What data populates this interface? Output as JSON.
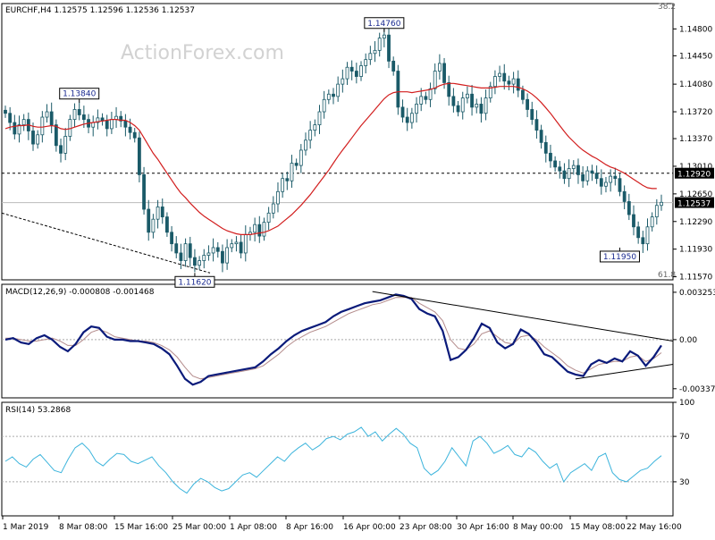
{
  "chart_data": [
    {
      "type": "candlestick",
      "title": "EURCHF,H4  1.12575 1.12596 1.12536 1.12537",
      "watermark": "ActionForex.com",
      "ylim": [
        1.1153,
        1.1513
      ],
      "y_ticks": [
        "1.14800",
        "1.14450",
        "1.14080",
        "1.13720",
        "1.13370",
        "1.13010",
        "1.12650",
        "1.12290",
        "1.11930",
        "1.11570"
      ],
      "x_ticks": [
        "1 Mar 2019",
        "8 Mar 08:00",
        "15 Mar 16:00",
        "25 Mar 00:00",
        "1 Apr 08:00",
        "8 Apr 16:00",
        "16 Apr 00:00",
        "23 Apr 08:00",
        "30 Apr 16:00",
        "8 May 00:00",
        "15 May 08:00",
        "22 May 16:00"
      ],
      "fib_labels": [
        "38.2",
        "61.8"
      ],
      "current_price": "1.12537",
      "horizontal_line": {
        "value": 1.1292,
        "label": "1.12920"
      },
      "callouts": [
        {
          "label": "1.13840",
          "x": 16,
          "y": 1.1384
        },
        {
          "label": "1.14760",
          "x": 84,
          "y": 1.1476
        },
        {
          "label": "1.11620",
          "x": 42,
          "y": 1.1162
        },
        {
          "label": "1.11950",
          "x": 136,
          "y": 1.1195
        }
      ],
      "close": [
        1.137,
        1.1358,
        1.1343,
        1.1355,
        1.1362,
        1.1347,
        1.133,
        1.1342,
        1.1365,
        1.1372,
        1.1355,
        1.1328,
        1.1318,
        1.134,
        1.1362,
        1.1375,
        1.1368,
        1.1362,
        1.1352,
        1.1358,
        1.1364,
        1.136,
        1.135,
        1.1362,
        1.1366,
        1.136,
        1.1352,
        1.1345,
        1.1338,
        1.129,
        1.1245,
        1.1215,
        1.1232,
        1.1248,
        1.1235,
        1.1215,
        1.12,
        1.1188,
        1.1178,
        1.12,
        1.1182,
        1.1172,
        1.1178,
        1.1185,
        1.1188,
        1.1195,
        1.119,
        1.1175,
        1.1195,
        1.12,
        1.1202,
        1.1188,
        1.1212,
        1.1215,
        1.1225,
        1.121,
        1.1228,
        1.124,
        1.1252,
        1.1268,
        1.1285,
        1.1282,
        1.1305,
        1.1302,
        1.1322,
        1.1335,
        1.1348,
        1.1355,
        1.1372,
        1.1388,
        1.1395,
        1.1392,
        1.1408,
        1.1415,
        1.143,
        1.1425,
        1.1418,
        1.1432,
        1.144,
        1.1448,
        1.1452,
        1.1468,
        1.1472,
        1.1438,
        1.1425,
        1.1378,
        1.1365,
        1.1358,
        1.137,
        1.1382,
        1.1392,
        1.1388,
        1.1402,
        1.1425,
        1.1435,
        1.141,
        1.1392,
        1.138,
        1.1372,
        1.139,
        1.1395,
        1.1378,
        1.1382,
        1.137,
        1.139,
        1.1405,
        1.1418,
        1.1422,
        1.1412,
        1.1408,
        1.1415,
        1.14,
        1.1388,
        1.1375,
        1.1362,
        1.1348,
        1.1332,
        1.1318,
        1.1308,
        1.13,
        1.1295,
        1.1285,
        1.1298,
        1.1302,
        1.129,
        1.1282,
        1.1295,
        1.1292,
        1.1285,
        1.1275,
        1.128,
        1.1288,
        1.1285,
        1.1268,
        1.1255,
        1.1238,
        1.1222,
        1.1208,
        1.12,
        1.1222,
        1.1235,
        1.125,
        1.1254
      ],
      "ma_line": [
        1.135,
        1.1352,
        1.1353,
        1.1354,
        1.1354,
        1.1355,
        1.1353,
        1.1352,
        1.1352,
        1.1353,
        1.1354,
        1.1353,
        1.135,
        1.1349,
        1.135,
        1.1352,
        1.1354,
        1.1356,
        1.1357,
        1.1358,
        1.1359,
        1.136,
        1.1361,
        1.1362,
        1.1362,
        1.1361,
        1.1361,
        1.1358,
        1.1354,
        1.1348,
        1.1338,
        1.1328,
        1.1318,
        1.131,
        1.1301,
        1.1292,
        1.1283,
        1.1274,
        1.1266,
        1.126,
        1.1253,
        1.1247,
        1.1241,
        1.1236,
        1.1232,
        1.1228,
        1.1224,
        1.122,
        1.1217,
        1.1215,
        1.1213,
        1.1212,
        1.1212,
        1.1212,
        1.1213,
        1.1214,
        1.1215,
        1.1217,
        1.122,
        1.1223,
        1.1228,
        1.1233,
        1.1238,
        1.1244,
        1.125,
        1.1257,
        1.1264,
        1.1272,
        1.128,
        1.1288,
        1.1296,
        1.1305,
        1.1314,
        1.1322,
        1.133,
        1.1338,
        1.1346,
        1.1354,
        1.1361,
        1.1368,
        1.1375,
        1.1382,
        1.1389,
        1.1394,
        1.1397,
        1.1398,
        1.1398,
        1.1398,
        1.1397,
        1.1398,
        1.1399,
        1.14,
        1.1401,
        1.1403,
        1.1406,
        1.1408,
        1.1409,
        1.1409,
        1.1408,
        1.1407,
        1.1406,
        1.1405,
        1.1404,
        1.1403,
        1.1403,
        1.1403,
        1.1404,
        1.1405,
        1.1405,
        1.1405,
        1.1405,
        1.1404,
        1.1402,
        1.1399,
        1.1395,
        1.139,
        1.1384,
        1.1377,
        1.137,
        1.1362,
        1.1354,
        1.1346,
        1.1339,
        1.1333,
        1.1327,
        1.1322,
        1.1318,
        1.1314,
        1.1311,
        1.1307,
        1.1303,
        1.13,
        1.1298,
        1.1295,
        1.1292,
        1.1288,
        1.1284,
        1.128,
        1.1276,
        1.1273,
        1.1272,
        1.1272
      ]
    },
    {
      "type": "line",
      "title": "MACD(12,26,9) -0.000808 -0.001468",
      "ylim": [
        -0.004,
        0.0038
      ],
      "y_ticks": [
        "0.003253",
        "0.00",
        "-0.003373"
      ],
      "zero_level": 0.0,
      "series": [
        {
          "name": "MACD",
          "color": "#0a1a7a",
          "values": [
            0.0,
            0.0001,
            -0.0002,
            -0.0003,
            0.0001,
            0.0003,
            0.0,
            -0.0005,
            -0.0008,
            -0.0003,
            0.0005,
            0.0009,
            0.0008,
            0.0002,
            0.0,
            0.0,
            -0.0001,
            -0.0001,
            -0.0002,
            -0.0003,
            -0.0006,
            -0.001,
            -0.0018,
            -0.0027,
            -0.0031,
            -0.0029,
            -0.0025,
            -0.0024,
            -0.0023,
            -0.0022,
            -0.0021,
            -0.002,
            -0.0019,
            -0.0015,
            -0.001,
            -0.0006,
            -0.0001,
            0.0003,
            0.0006,
            0.0008,
            0.001,
            0.0012,
            0.0016,
            0.0019,
            0.0021,
            0.0023,
            0.0025,
            0.0026,
            0.0027,
            0.0029,
            0.0031,
            0.003,
            0.0028,
            0.0021,
            0.0018,
            0.0016,
            0.0006,
            -0.0014,
            -0.0012,
            -0.0007,
            0.0001,
            0.0011,
            0.0008,
            -0.0002,
            -0.0006,
            -0.0003,
            0.0007,
            0.0004,
            -0.0002,
            -0.001,
            -0.0012,
            -0.0017,
            -0.0022,
            -0.0024,
            -0.0025,
            -0.0017,
            -0.0014,
            -0.0016,
            -0.0013,
            -0.0015,
            -0.0008,
            -0.0011,
            -0.0018,
            -0.0012,
            -0.0004
          ]
        },
        {
          "name": "Signal",
          "color": "#b48c8c",
          "values": [
            0.0001,
            0.0001,
            0.0,
            -0.0001,
            -0.0001,
            0.0,
            0.0001,
            -0.0001,
            -0.0004,
            -0.0004,
            0.0,
            0.0005,
            0.0007,
            0.0005,
            0.0002,
            0.0001,
            0.0,
            -0.0001,
            -0.0001,
            -0.0002,
            -0.0004,
            -0.0007,
            -0.0012,
            -0.0019,
            -0.0025,
            -0.0027,
            -0.0026,
            -0.0025,
            -0.0024,
            -0.0023,
            -0.0022,
            -0.0021,
            -0.002,
            -0.0018,
            -0.0014,
            -0.001,
            -0.0005,
            -0.0001,
            0.0002,
            0.0005,
            0.0007,
            0.0009,
            0.0012,
            0.0015,
            0.0018,
            0.002,
            0.0022,
            0.0024,
            0.0025,
            0.0027,
            0.0029,
            0.0029,
            0.0029,
            0.0025,
            0.0022,
            0.0019,
            0.0013,
            0.0,
            -0.0006,
            -0.0007,
            -0.0003,
            0.0004,
            0.0006,
            0.0002,
            -0.0002,
            -0.0003,
            0.0002,
            0.0003,
            0.0,
            -0.0005,
            -0.0009,
            -0.0013,
            -0.0018,
            -0.0021,
            -0.0023,
            -0.002,
            -0.0017,
            -0.0016,
            -0.0015,
            -0.0015,
            -0.0012,
            -0.0011,
            -0.0015,
            -0.0013,
            -0.0009
          ]
        }
      ],
      "trendlines": [
        {
          "from": [
            47,
            0.0033
          ],
          "to": [
            84,
            -0.0001
          ]
        },
        {
          "from": [
            73,
            -0.0027
          ],
          "to": [
            84,
            -0.0017
          ]
        }
      ]
    },
    {
      "type": "line",
      "title": "RSI(14) 53.2868",
      "ylim": [
        0,
        100
      ],
      "y_ticks": [
        "100",
        "70",
        "30",
        "0"
      ],
      "levels": [
        70,
        30
      ],
      "series": [
        {
          "name": "RSI",
          "color": "#3cb4dc",
          "values": [
            48,
            52,
            46,
            43,
            50,
            54,
            47,
            40,
            38,
            50,
            60,
            64,
            58,
            48,
            44,
            50,
            55,
            54,
            48,
            46,
            49,
            52,
            44,
            38,
            30,
            24,
            20,
            28,
            33,
            30,
            25,
            22,
            24,
            30,
            36,
            38,
            34,
            40,
            46,
            52,
            48,
            55,
            60,
            64,
            58,
            62,
            68,
            70,
            67,
            72,
            74,
            78,
            70,
            74,
            66,
            72,
            77,
            72,
            64,
            60,
            42,
            36,
            40,
            48,
            60,
            52,
            44,
            66,
            70,
            64,
            55,
            58,
            62,
            54,
            52,
            60,
            56,
            48,
            42,
            46,
            30,
            38,
            42,
            46,
            40,
            52,
            55,
            38,
            32,
            30,
            35,
            40,
            42,
            48,
            53
          ]
        }
      ]
    }
  ]
}
